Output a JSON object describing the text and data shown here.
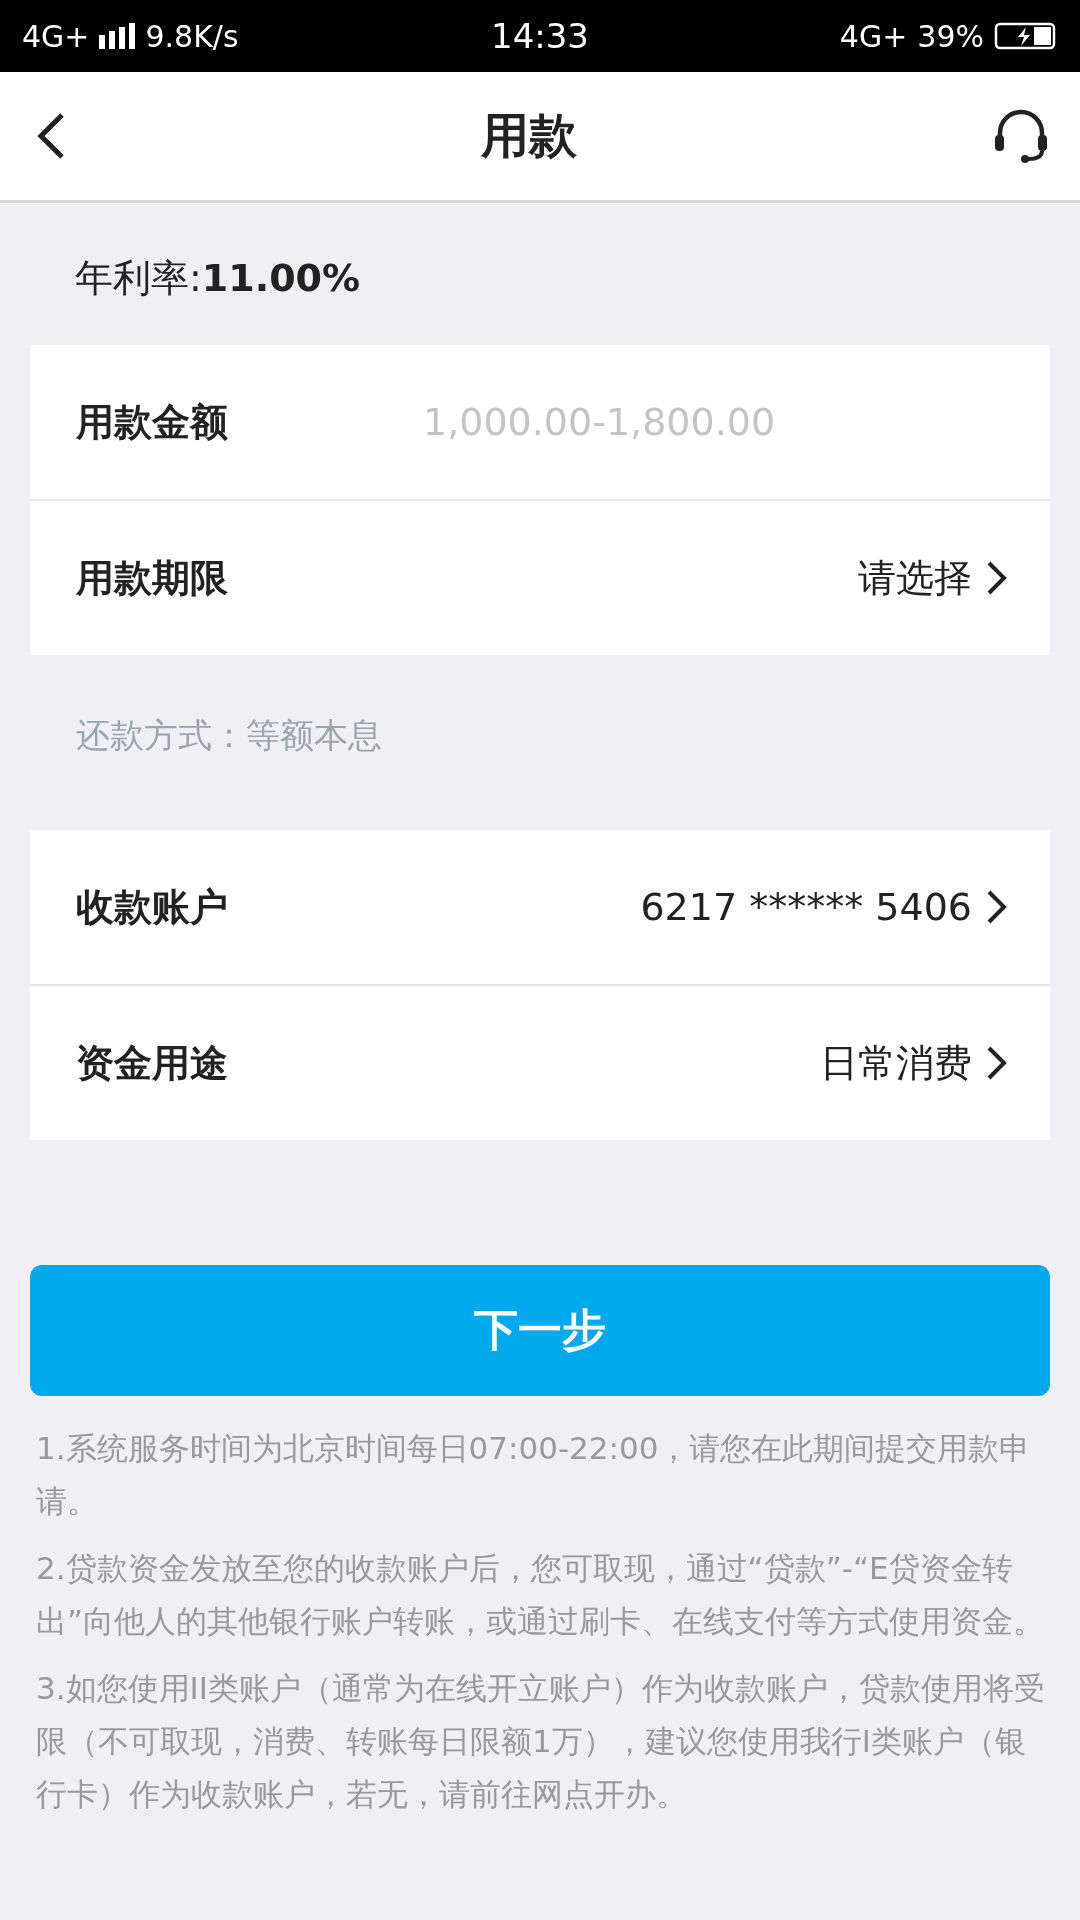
{
  "status_bar": {
    "network": "4G+",
    "speed": "9.8K/s",
    "time": "14:33",
    "network_right": "4G+",
    "battery": "39%"
  },
  "header": {
    "title": "用款"
  },
  "rate": {
    "label": "年利率:",
    "value": "11.00%"
  },
  "form_top": [
    {
      "kind": "input",
      "label": "用款金额",
      "placeholder": "1,000.00-1,800.00"
    },
    {
      "kind": "select",
      "label": "用款期限",
      "value": "请选择"
    }
  ],
  "repayment": "还款方式：等额本息",
  "form_bottom": [
    {
      "kind": "select",
      "label": "收款账户",
      "value": "6217 ****** 5406"
    },
    {
      "kind": "select",
      "label": "资金用途",
      "value": "日常消费"
    }
  ],
  "next_button": "下一步",
  "notes": [
    "1.系统服务时间为北京时间每日07:00-22:00，请您在此期间提交用款申请。",
    "2.贷款资金发放至您的收款账户后，您可取现，通过“贷款”-“E贷资金转出”向他人的其他银行账户转账，或通过刷卡、在线支付等方式使用资金。",
    "3.如您使用II类账户（通常为在线开立账户）作为收款账户，贷款使用将受限（不可取现，消费、转账每日限额1万），建议您使用我行I类账户（银行卡）作为收款账户，若无，请前往网点开办。"
  ]
}
